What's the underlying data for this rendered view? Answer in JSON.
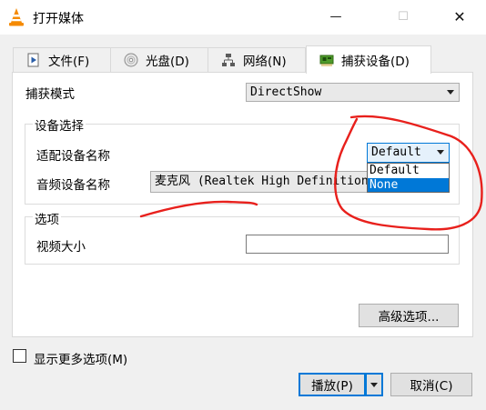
{
  "window": {
    "title": "打开媒体",
    "minimize_glyph": "—",
    "maximize_glyph": "☐",
    "close_glyph": "✕"
  },
  "tabs": [
    {
      "label": "文件(F)",
      "icon": "file-play-icon",
      "selected": false
    },
    {
      "label": "光盘(D)",
      "icon": "disc-icon",
      "selected": false
    },
    {
      "label": "网络(N)",
      "icon": "network-icon",
      "selected": false
    },
    {
      "label": "捕获设备(D)",
      "icon": "capture-card-icon",
      "selected": true
    }
  ],
  "capture": {
    "mode_label": "捕获模式",
    "mode_value": "DirectShow"
  },
  "device_group": {
    "title": "设备选择",
    "video_label": "适配设备名称",
    "video_value": "Default",
    "video_options": [
      "Default",
      "None"
    ],
    "video_highlighted": "None",
    "audio_label": "音频设备名称",
    "audio_value": "麦克风 (Realtek High Definition"
  },
  "options_group": {
    "title": "选项",
    "video_size_label": "视频大小",
    "video_size_value": ""
  },
  "advanced_button": "高级选项...",
  "show_more": {
    "label": "显示更多选项(M)",
    "checked": false
  },
  "footer": {
    "play_label": "播放(P)",
    "cancel_label": "取消(C)"
  },
  "colors": {
    "accent": "#0078d7",
    "annotation": "#e8201c",
    "vlc_orange": "#f58a00"
  }
}
